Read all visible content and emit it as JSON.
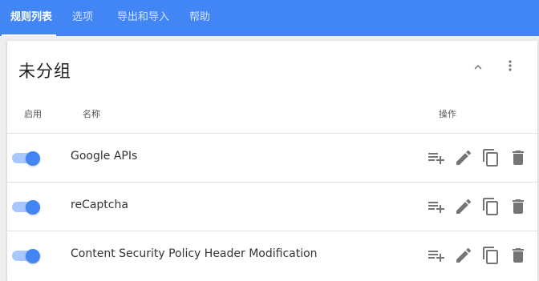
{
  "tabs": [
    {
      "label": "规则列表",
      "active": true
    },
    {
      "label": "选项",
      "active": false
    },
    {
      "label": "导出和导入",
      "active": false
    },
    {
      "label": "帮助",
      "active": false
    }
  ],
  "group": {
    "title": "未分组",
    "collapse_icon": "chevron-up-icon",
    "menu_icon": "more-vert-icon"
  },
  "columns": {
    "enabled": "启用",
    "name": "名称",
    "actions": "操作"
  },
  "rules": [
    {
      "name": "Google APIs",
      "enabled": true
    },
    {
      "name": "reCaptcha",
      "enabled": true
    },
    {
      "name": "Content Security Policy Header Modification",
      "enabled": true
    }
  ],
  "action_icons": [
    "playlist-add-icon",
    "edit-icon",
    "copy-icon",
    "delete-icon"
  ],
  "colors": {
    "primary": "#4285f4",
    "toggle_track": "#a6c8ff",
    "icon": "#757575",
    "background": "#eeeeee"
  }
}
